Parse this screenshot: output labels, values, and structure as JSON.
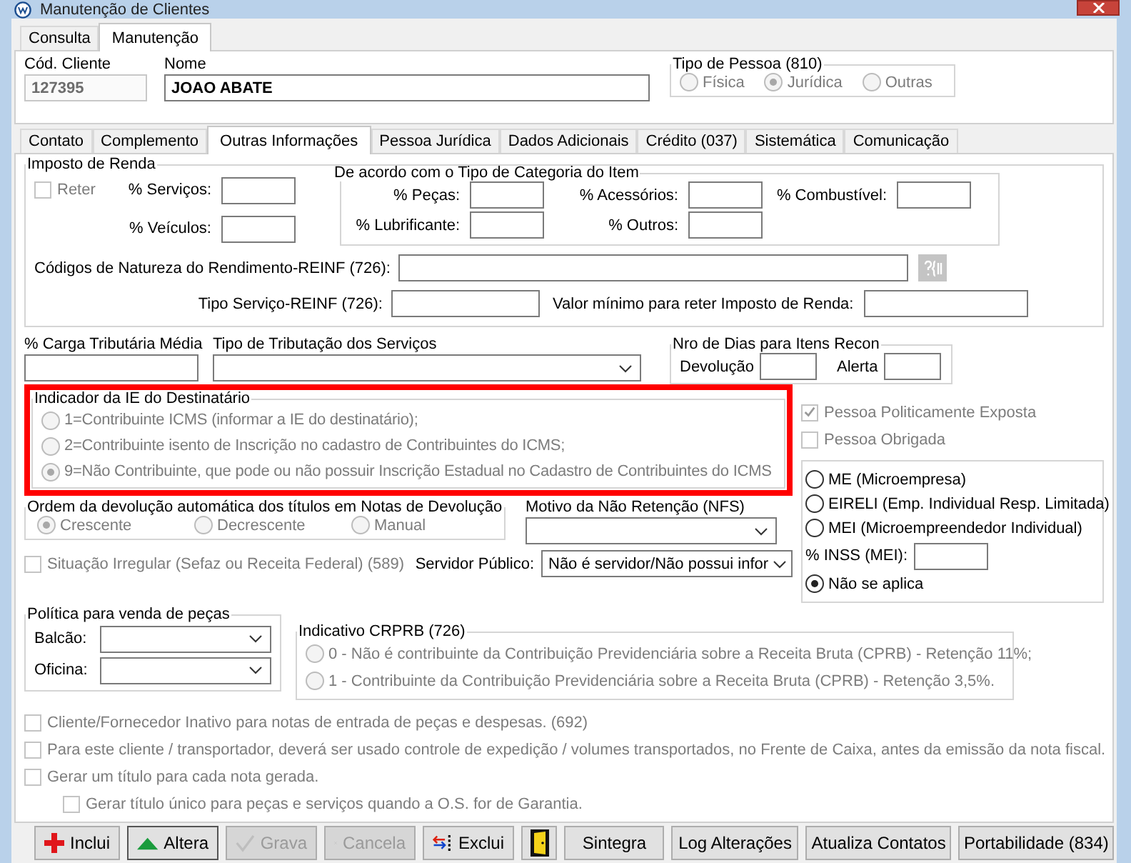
{
  "window": {
    "title": "Manutenção de Clientes"
  },
  "main_tabs": [
    {
      "label": "Consulta",
      "selected": false
    },
    {
      "label": "Manutenção",
      "selected": true
    }
  ],
  "header": {
    "code": {
      "label": "Cód. Cliente",
      "value": "127395",
      "disabled": true
    },
    "name": {
      "label": "Nome",
      "value": "JOAO ABATE"
    },
    "person_type": {
      "title": "Tipo de Pessoa (810)",
      "disabled": true,
      "options": [
        {
          "label": "Física",
          "selected": false
        },
        {
          "label": "Jurídica",
          "selected": true
        },
        {
          "label": "Outras",
          "selected": false
        }
      ]
    }
  },
  "tabs": [
    {
      "label": "Contato",
      "selected": false
    },
    {
      "label": "Complemento",
      "selected": false
    },
    {
      "label": "Outras Informações",
      "selected": true
    },
    {
      "label": "Pessoa Jurídica",
      "selected": false
    },
    {
      "label": "Dados Adicionais",
      "selected": false
    },
    {
      "label": "Crédito (037)",
      "selected": false
    },
    {
      "label": "Sistemática",
      "selected": false
    },
    {
      "label": "Comunicação",
      "selected": false
    }
  ],
  "imposto_renda": {
    "title": "Imposto de Renda",
    "reter": {
      "label": "Reter",
      "checked": false,
      "disabled": true
    },
    "fields": [
      {
        "label": "% Serviços:"
      },
      {
        "label": "% Veículos:"
      }
    ]
  },
  "categoria": {
    "title": "De acordo com o Tipo de Categoria do Item",
    "fields": [
      {
        "label": "% Peças:"
      },
      {
        "label": "% Acessórios:"
      },
      {
        "label": "% Combustível:"
      },
      {
        "label": "% Lubrificante:"
      },
      {
        "label": "% Outros:"
      }
    ]
  },
  "reinf": {
    "codes_label": "Códigos de Natureza do Rendimento-REINF (726):",
    "service_label": "Tipo Serviço-REINF (726):",
    "min_value_label": "Valor mínimo para reter Imposto de Renda:"
  },
  "carga": {
    "label": "% Carga Tributária Média"
  },
  "tributacao": {
    "label": "Tipo de Tributação dos Serviços"
  },
  "dias_recon": {
    "title": "Nro de Dias para Itens Recon",
    "fields": [
      {
        "label": "Devolução"
      },
      {
        "label": "Alerta"
      }
    ]
  },
  "indicador_ie": {
    "title": "Indicador da IE do Destinatário",
    "highlighted": true,
    "disabled": true,
    "options": [
      {
        "label": "1=Contribuinte ICMS (informar a IE do destinatário);",
        "selected": false
      },
      {
        "label": "2=Contribuinte isento de Inscrição no cadastro de Contribuintes do ICMS;",
        "selected": false
      },
      {
        "label": "9=Não Contribuinte, que pode ou não possuir Inscrição Estadual no Cadastro de Contribuintes do ICMS",
        "selected": true
      }
    ]
  },
  "pessoa_checks": [
    {
      "label": "Pessoa Politicamente Exposta",
      "checked": true,
      "disabled": true
    },
    {
      "label": "Pessoa Obrigada",
      "checked": false,
      "disabled": true
    }
  ],
  "ordem_devolucao": {
    "title": "Ordem da devolução automática dos títulos em Notas de Devolução",
    "disabled": true,
    "options": [
      {
        "label": "Crescente",
        "selected": true
      },
      {
        "label": "Decrescente",
        "selected": false
      },
      {
        "label": "Manual",
        "selected": false
      }
    ]
  },
  "motivo": {
    "label": "Motivo da Não Retenção (NFS)"
  },
  "situacao": {
    "label": "Situação Irregular (Sefaz ou Receita Federal) (589)",
    "checked": false,
    "disabled": true
  },
  "servidor": {
    "label": "Servidor Público:",
    "value": "Não é servidor/Não possui infor"
  },
  "porte": {
    "inss_label": "% INSS (MEI):",
    "options": [
      {
        "label": "ME (Microempresa)",
        "selected": false
      },
      {
        "label": "EIRELI (Emp. Individual Resp. Limitada)",
        "selected": false
      },
      {
        "label": "MEI (Microempreendedor Individual)",
        "selected": false
      },
      {
        "label": "Não se aplica",
        "selected": true
      }
    ]
  },
  "politica": {
    "title": "Política para venda de peças",
    "fields": [
      {
        "label": "Balcão:"
      },
      {
        "label": "Oficina:"
      }
    ]
  },
  "crprb": {
    "title": "Indicativo CRPRB (726)",
    "disabled": true,
    "options": [
      {
        "label": "0 - Não é contribuinte da Contribuição Previdenciária sobre a Receita Bruta (CPRB) - Retenção 11%;",
        "selected": false
      },
      {
        "label": "1 - Contribuinte da Contribuição Previdenciária sobre a Receita Bruta (CPRB) - Retenção 3,5%.",
        "selected": false
      }
    ]
  },
  "checks": [
    {
      "label": "Cliente/Fornecedor Inativo para notas de entrada de peças e despesas. (692)",
      "checked": false,
      "disabled": true
    },
    {
      "label": "Para este cliente / transportador, deverá ser usado controle de expedição / volumes transportados, no Frente de Caixa, antes da emissão da nota fiscal.",
      "checked": false,
      "disabled": true
    },
    {
      "label": "Gerar um título para cada nota gerada.",
      "checked": false,
      "disabled": true,
      "children": [
        {
          "label": "Gerar título único para peças e serviços quando a O.S. for de Garantia.",
          "checked": false,
          "disabled": true
        }
      ]
    }
  ],
  "buttons": [
    {
      "kind": "add",
      "label": "Inclui",
      "disabled": false
    },
    {
      "kind": "edit",
      "label": "Altera",
      "disabled": false
    },
    {
      "kind": "save",
      "label": "Grava",
      "disabled": true
    },
    {
      "kind": "cancel",
      "label": "Cancela",
      "disabled": true
    },
    {
      "kind": "delete",
      "label": "Exclui",
      "disabled": false
    },
    {
      "kind": "door"
    },
    {
      "kind": "text",
      "label": "Sintegra",
      "disabled": false
    },
    {
      "kind": "text",
      "label": "Log Alterações",
      "disabled": false
    },
    {
      "kind": "text",
      "label": "Atualiza Contatos",
      "disabled": false
    },
    {
      "kind": "text",
      "label": "Portabilidade (834)",
      "disabled": false
    }
  ]
}
